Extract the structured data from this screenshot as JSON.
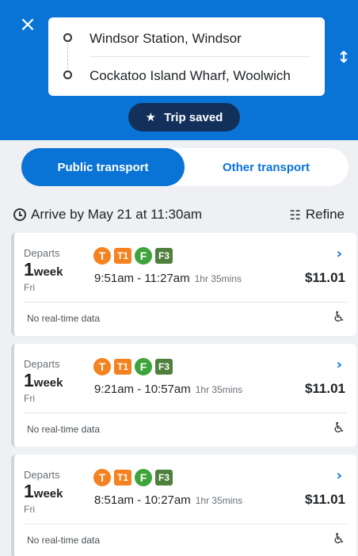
{
  "header": {
    "close_icon": "×",
    "from": "Windsor Station, Windsor",
    "to": "Cockatoo Island Wharf, Woolwich",
    "swap_icon": "↕",
    "saved_star": "★",
    "saved_label": "Trip saved"
  },
  "mode_tabs": {
    "public": "Public transport",
    "other": "Other transport"
  },
  "arrive": {
    "text": "Arrive by May 21 at 11:30am",
    "refine_icon": "☷",
    "refine_label": "Refine"
  },
  "trip_common": {
    "departs_label": "Departs",
    "departs_big": "1",
    "departs_unit": "week",
    "departs_day": "Fri",
    "badge_t": "T",
    "badge_t1": "T1",
    "badge_f": "F",
    "badge_f3": "F3",
    "realtime": "No real-time data",
    "chevron": "›",
    "wheelchair": "♿",
    "colors": {
      "train": "#f58220",
      "ferry": "#3ea33a",
      "f3": "#4f7f3d",
      "accent": "#0a73d6"
    }
  },
  "trips": [
    {
      "time": "9:51am - 11:27am",
      "duration": "1hr 35mins",
      "price": "$11.01"
    },
    {
      "time": "9:21am - 10:57am",
      "duration": "1hr 35mins",
      "price": "$11.01"
    },
    {
      "time": "8:51am - 10:27am",
      "duration": "1hr 35mins",
      "price": "$11.01"
    }
  ]
}
